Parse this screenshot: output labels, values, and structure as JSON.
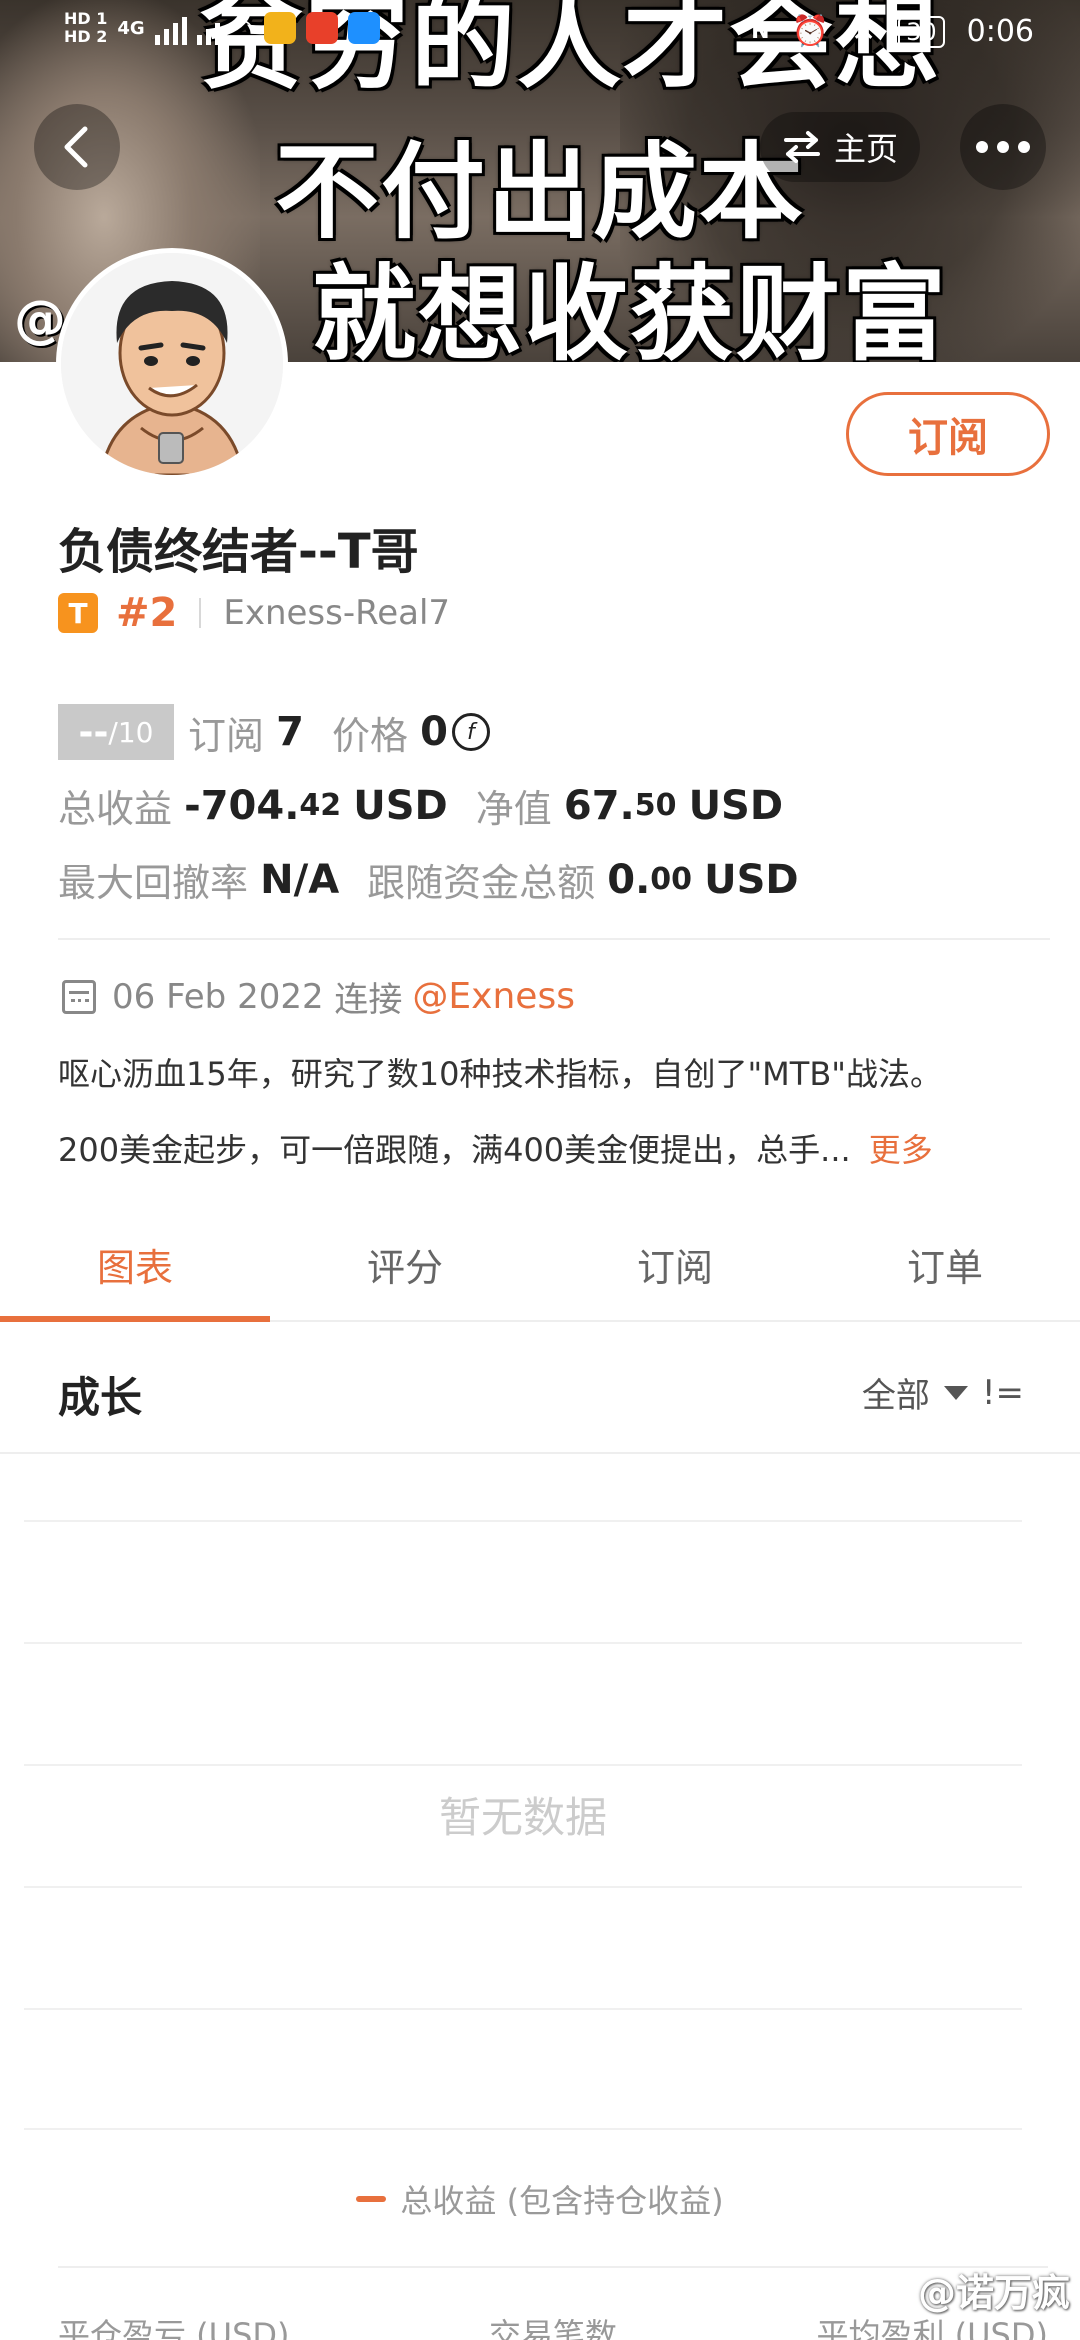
{
  "status_bar": {
    "tag_hd1": "HD 1",
    "tag_hd2": "HD 2",
    "network": "4G",
    "battery": "30",
    "time": "0:06"
  },
  "banner": {
    "line1": "贫穷的人才会想",
    "line2": "不付出成本",
    "line3": "就想收获财富",
    "handle_fragment": "@"
  },
  "header": {
    "home_label": "主页",
    "subscribe_label": "订阅"
  },
  "profile": {
    "name": "负债终结者--T哥",
    "badge": "T",
    "rank": "#2",
    "server": "Exness-Real7"
  },
  "stats": {
    "score": "--",
    "score_den": "/10",
    "subscribe_label": "订阅",
    "subscribe_count": "7",
    "price_label": "价格",
    "price": "0",
    "total_profit_label": "总收益",
    "total_profit_int": "-704.",
    "total_profit_dec": "42",
    "total_profit_unit": "USD",
    "equity_label": "净值",
    "equity_int": "67.",
    "equity_dec": "50",
    "equity_unit": "USD",
    "max_dd_label": "最大回撤率",
    "max_dd": "N/A",
    "follow_fund_label": "跟随资金总额",
    "follow_fund_int": "0.",
    "follow_fund_dec": "00",
    "follow_fund_unit": "USD"
  },
  "connection": {
    "date": "06 Feb 2022",
    "label": "连接",
    "broker": "@Exness"
  },
  "bio": {
    "line1": "呕心沥血15年，研究了数10种技术指标，自创了\"MTB\"战法。",
    "line2": "200美金起步，可一倍跟随，满400美金便提出，总手...",
    "more": "更多"
  },
  "tabs": [
    {
      "label": "图表",
      "active": true
    },
    {
      "label": "评分",
      "active": false
    },
    {
      "label": "订阅",
      "active": false
    },
    {
      "label": "订单",
      "active": false
    }
  ],
  "section": {
    "title": "成长",
    "filter": "全部"
  },
  "chart": {
    "empty_text": "暂无数据",
    "legend": "总收益 (包含持仓收益)"
  },
  "bottom_labels": [
    "平仓盈亏 (USD)",
    "交易笔数",
    "平均盈利 (USD)"
  ],
  "watermark": "@诺万疯",
  "colors": {
    "accent": "#e8703d",
    "badge": "#f7931e"
  }
}
